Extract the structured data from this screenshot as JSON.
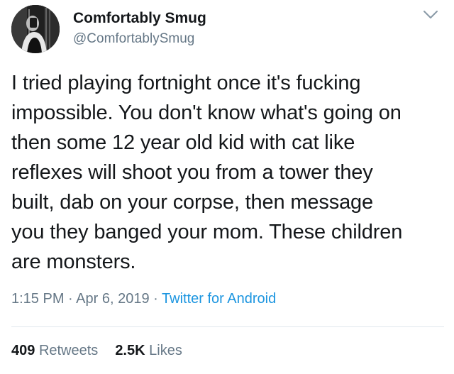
{
  "user": {
    "display_name": "Comfortably Smug",
    "handle": "@ComfortablySmug"
  },
  "tweet": {
    "text": "I tried playing fortnight once it's fucking\nimpossible. You don't know what's going on\nthen some 12 year old kid with cat like\nreflexes will shoot you from a tower they\nbuilt, dab on your corpse, then message\nyou they banged your mom. These children\nare monsters.",
    "time": "1:15 PM",
    "date": "Apr 6, 2019",
    "separator": "·",
    "source": "Twitter for Android"
  },
  "stats": {
    "retweets_count": "409",
    "retweets_label": "Retweets",
    "likes_count": "2.5K",
    "likes_label": "Likes"
  },
  "icons": {
    "menu": "chevron-down-icon"
  },
  "colors": {
    "text": "#14171a",
    "secondary": "#657786",
    "link": "#1b95e0",
    "divider": "#e1e8ed"
  }
}
